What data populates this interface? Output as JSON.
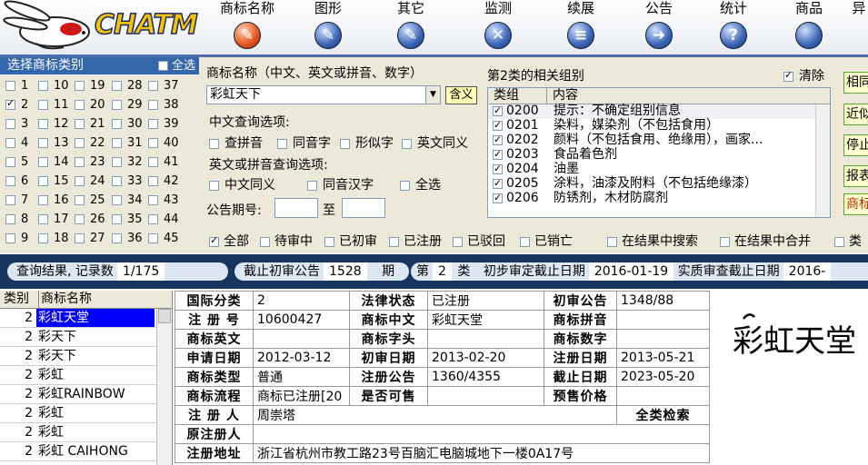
{
  "app": {
    "logo_text": "CHATM"
  },
  "nav": [
    {
      "label": "商标名称",
      "active": true
    },
    {
      "label": "图形",
      "active": false
    },
    {
      "label": "其它",
      "active": false
    },
    {
      "label": "监测",
      "active": false
    },
    {
      "label": "续展",
      "active": false
    },
    {
      "label": "公告",
      "active": false
    },
    {
      "label": "统计",
      "active": false
    },
    {
      "label": "商品",
      "active": false
    },
    {
      "label": "异",
      "active": false
    }
  ],
  "categories": {
    "header": "选择商标类别",
    "select_all": "全选",
    "selected": [
      "2"
    ],
    "columns": [
      [
        "1",
        "2",
        "3",
        "4",
        "5",
        "6",
        "7",
        "8",
        "9"
      ],
      [
        "10",
        "11",
        "12",
        "13",
        "14",
        "15",
        "16",
        "17",
        "18"
      ],
      [
        "19",
        "20",
        "21",
        "22",
        "23",
        "24",
        "25",
        "26",
        "27"
      ],
      [
        "28",
        "29",
        "30",
        "31",
        "32",
        "33",
        "34",
        "35",
        "36"
      ],
      [
        "37",
        "38",
        "39",
        "40",
        "41",
        "42",
        "43",
        "44",
        "45"
      ]
    ]
  },
  "search": {
    "name_label": "商标名称（中文、英文或拼音、数字）",
    "name_value": "彩虹天下",
    "meaning_button": "含义",
    "cn_options_label": "中文查询选项:",
    "cn_options": [
      "查拼音",
      "同音字",
      "形似字",
      "英文同义"
    ],
    "en_options_label": "英文或拼音查询选项:",
    "en_options": [
      "中文同义",
      "同音汉字",
      "全选"
    ],
    "period_label": "公告期号:",
    "period_to": "至",
    "period_from_value": "",
    "period_to_value": ""
  },
  "groups": {
    "title": "第2类的相关组别",
    "clear_label": "清除",
    "clear_checked": true,
    "col_group": "类组",
    "col_content": "内容",
    "rows": [
      {
        "code": "0200",
        "content": "提示：不确定组别信息"
      },
      {
        "code": "0201",
        "content": "染料，媒染剂（不包括食用）"
      },
      {
        "code": "0202",
        "content": "颜料（不包括食用、绝缘用），画家..."
      },
      {
        "code": "0203",
        "content": "食品着色剂"
      },
      {
        "code": "0204",
        "content": "油墨"
      },
      {
        "code": "0205",
        "content": "涂料，油漆及附料（不包括绝缘漆）"
      },
      {
        "code": "0206",
        "content": "防锈剂，木材防腐剂"
      }
    ]
  },
  "side_buttons": [
    "相同",
    "近似",
    "停止",
    "报表",
    "商标"
  ],
  "filters": [
    {
      "label": "全部",
      "checked": true
    },
    {
      "label": "待审中",
      "checked": false
    },
    {
      "label": "已初审",
      "checked": false
    },
    {
      "label": "已注册",
      "checked": false
    },
    {
      "label": "已驳回",
      "checked": false
    },
    {
      "label": "已销亡",
      "checked": false
    },
    {
      "label": "在结果中搜索",
      "checked": false
    },
    {
      "label": "在结果中合并",
      "checked": false
    },
    {
      "label": "类",
      "checked": false
    }
  ],
  "status": {
    "result_label": "查询结果, 记录数",
    "result_value": "1/175",
    "deadline_label": "截止初审公告",
    "deadline_value": "1528",
    "deadline_unit": "期",
    "class_prefix": "第",
    "class_value": "2",
    "class_suffix": "类",
    "prelim_label": "初步审定截止日期",
    "prelim_value": "2016-01-19",
    "final_label": "实质审查截止日期",
    "final_value": "2016-"
  },
  "results": {
    "col_class": "类别",
    "col_name": "商标名称",
    "rows": [
      {
        "cls": "2",
        "name": "彩虹天堂"
      },
      {
        "cls": "2",
        "name": "彩天下"
      },
      {
        "cls": "2",
        "name": "彩天下"
      },
      {
        "cls": "2",
        "name": "彩虹"
      },
      {
        "cls": "2",
        "name": "彩虹RAINBOW"
      },
      {
        "cls": "2",
        "name": "彩虹"
      },
      {
        "cls": "2",
        "name": "彩虹"
      },
      {
        "cls": "2",
        "name": "彩虹 CAIHONG"
      }
    ]
  },
  "detail": {
    "r1": [
      "国际分类",
      "2",
      "法律状态",
      "已注册",
      "初审公告",
      "1348/88"
    ],
    "r2": [
      "注 册 号",
      "10600427",
      "商标中文",
      "彩虹天堂",
      "商标拼音",
      ""
    ],
    "r3": [
      "商标英文",
      "",
      "商标字头",
      "",
      "商标数字",
      ""
    ],
    "r4": [
      "申请日期",
      "2012-03-12",
      "初审日期",
      "2013-02-20",
      "注册日期",
      "2013-05-21"
    ],
    "r5": [
      "商标类型",
      "普通",
      "注册公告",
      "1360/4355",
      "截止日期",
      "2023-05-20"
    ],
    "r6": [
      "商标流程",
      "商标已注册[20",
      "是否可售",
      "",
      "预售价格",
      ""
    ],
    "applicant_label": "注 册 人",
    "applicant_value": "周崇塔",
    "all_class_search": "全类检索",
    "orig_applicant_label": "原注册人",
    "orig_applicant_value": "",
    "address_label": "注册地址",
    "address_value": "浙江省杭州市教工路23号百脑汇电脑城地下一楼0A17号"
  },
  "preview": {
    "mark_text": "彩虹天堂"
  }
}
